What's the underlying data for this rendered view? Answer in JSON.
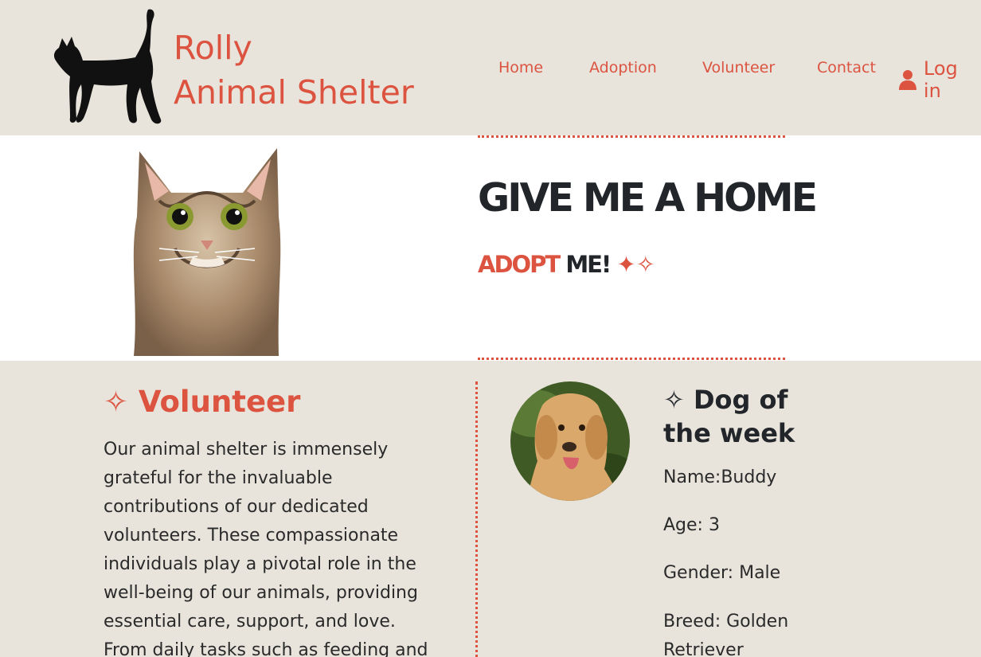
{
  "header": {
    "brand_line1": "Rolly",
    "brand_line2": "Animal Shelter",
    "logo_icon": "cat-silhouette-icon",
    "nav": [
      "Home",
      "Adoption",
      "Volunteer",
      "Contact"
    ],
    "login_label": "Log in",
    "login_icon": "user-icon"
  },
  "hero": {
    "title": "GIVE ME A HOME",
    "adopt": "ADOPT",
    "me": "ME!",
    "sparkles": "✦✧"
  },
  "volunteer": {
    "title": "✧ Volunteer",
    "text": "Our animal shelter is immensely grateful for the invaluable contributions of our dedicated volunteers. These compassionate individuals play a pivotal role in the well-being of our animals, providing essential care, support, and love. From daily tasks such as feeding and"
  },
  "dog_of_week": {
    "title": "✧ Dog of the week",
    "name": "Name:Buddy",
    "age": "Age: 3",
    "gender": "Gender: Male",
    "breed": "Breed: Golden Retriever"
  },
  "colors": {
    "accent": "#dc5340",
    "background": "#e8e4dc",
    "dark_text": "#22262b"
  }
}
